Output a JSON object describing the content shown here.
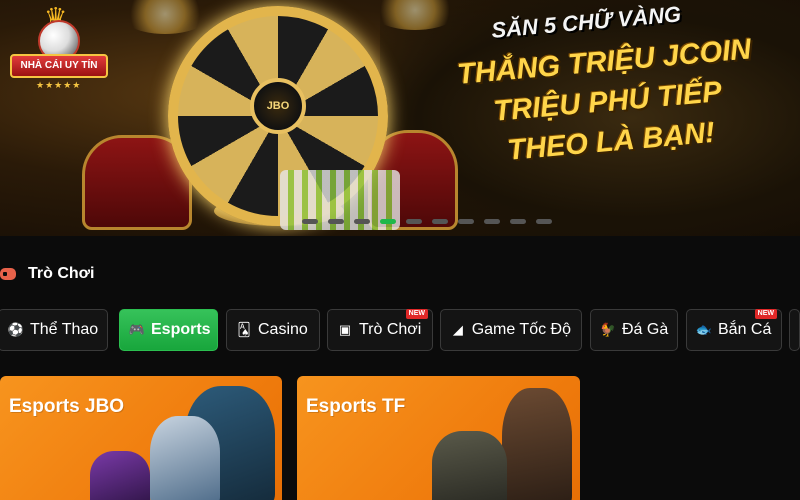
{
  "banner": {
    "logo_text": "NHÀ CÁI UY TÍN",
    "logo_stars": "★★★★★",
    "wheel_label": "JBO",
    "subheading": "SĂN 5 CHỮ VÀNG",
    "headline_lines": [
      "THẮNG TRIỆU JCOIN",
      "TRIỆU PHÚ TIẾP",
      "THEO LÀ BẠN!"
    ],
    "carousel_total": 10,
    "carousel_active_index": 3
  },
  "section": {
    "title": "Trò Chơi",
    "icon": "gamepad-icon"
  },
  "tabs": [
    {
      "label": "Thể Thao",
      "icon": "soccer-ball-icon",
      "active": false,
      "new": false
    },
    {
      "label": "Esports",
      "icon": "gamepad-icon",
      "active": true,
      "new": false
    },
    {
      "label": "Casino",
      "icon": "cards-icon",
      "active": false,
      "new": false
    },
    {
      "label": "Trò Chơi",
      "icon": "slot-machine-icon",
      "active": false,
      "new": true
    },
    {
      "label": "Game Tốc Độ",
      "icon": "speedometer-icon",
      "active": false,
      "new": false
    },
    {
      "label": "Đá Gà",
      "icon": "rooster-icon",
      "active": false,
      "new": false
    },
    {
      "label": "Bắn Cá",
      "icon": "fish-icon",
      "active": false,
      "new": true
    }
  ],
  "new_badge": "NEW",
  "cards": [
    {
      "title": "Esports JBO"
    },
    {
      "title": "Esports TF"
    }
  ],
  "colors": {
    "accent_green": "#1fb84a",
    "card_orange": "#f7941e",
    "headline_gold": "#ffd54a",
    "badge_red": "#e02828"
  }
}
